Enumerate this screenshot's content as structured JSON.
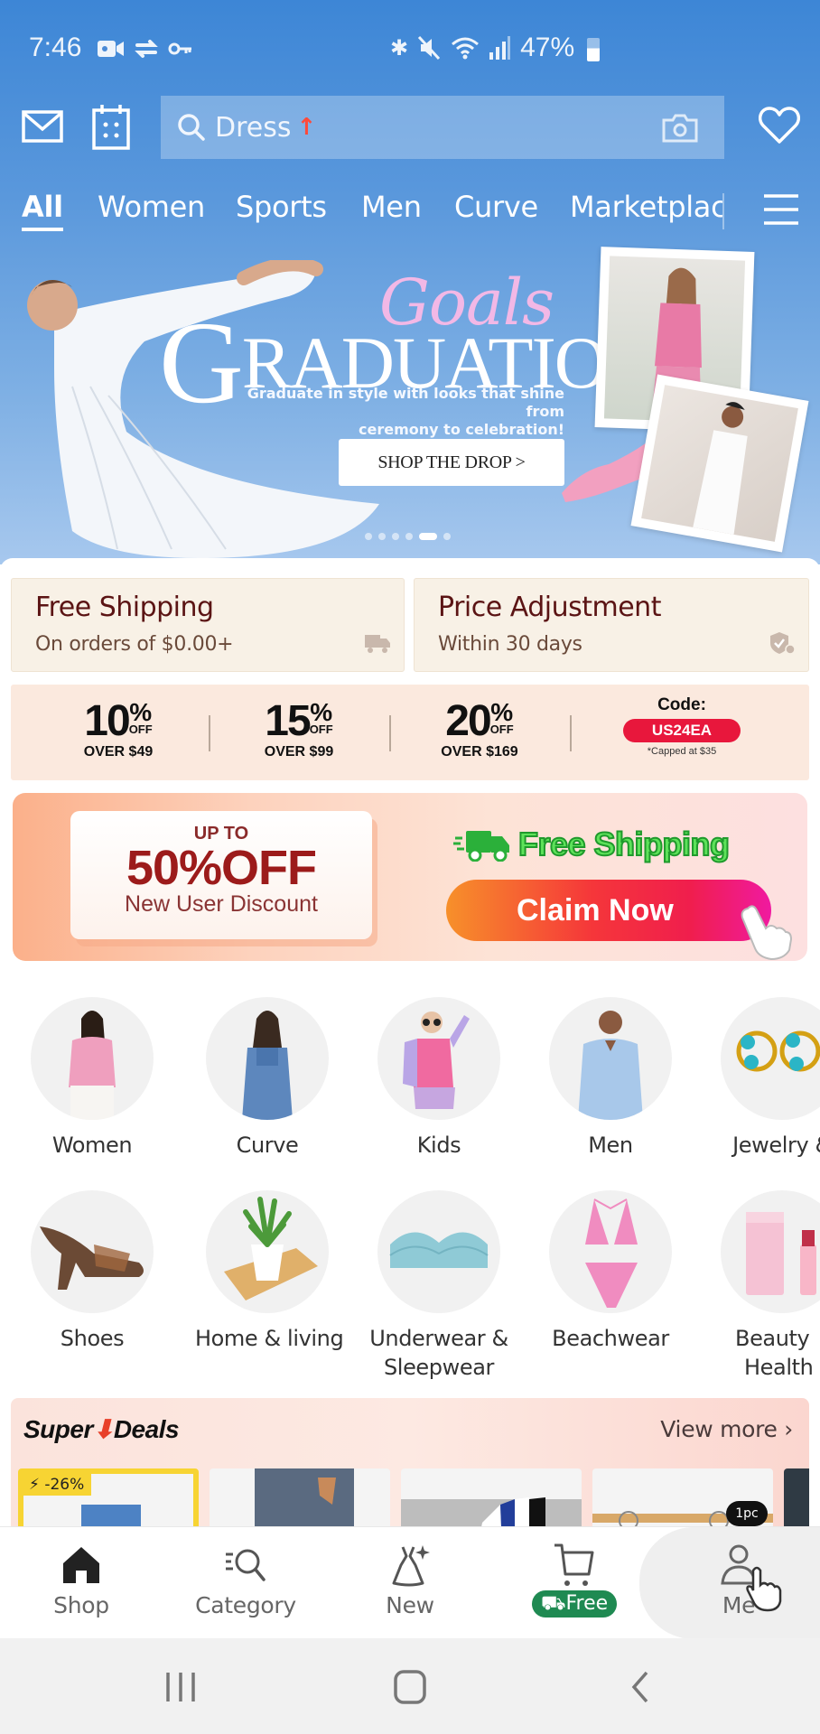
{
  "status_bar": {
    "time": "7:46",
    "left_icons": [
      "video-call-icon",
      "sync-icon",
      "key-icon"
    ],
    "right_icons": [
      "bluetooth-icon",
      "mute-icon",
      "wifi-icon",
      "signal-icon"
    ],
    "battery": "47%"
  },
  "header": {
    "search": {
      "term": "Dress",
      "trend_icon": "trending-up-arrow"
    },
    "tabs": [
      {
        "label": "All",
        "active": true
      },
      {
        "label": "Women"
      },
      {
        "label": "Sports"
      },
      {
        "label": "Men"
      },
      {
        "label": "Curve"
      },
      {
        "label": "Marketplace"
      }
    ]
  },
  "banner": {
    "script_title": "Goals",
    "title_initial": "G",
    "title_rest": "RADUATION",
    "subtitle_line1": "Graduate in style with looks that shine from",
    "subtitle_line2": "ceremony to celebration!",
    "cta": "SHOP THE DROP >",
    "slides_total": 6,
    "slide_active": 5
  },
  "services": [
    {
      "title": "Free Shipping",
      "subtitle": "On orders of $0.00+",
      "icon": "truck-icon"
    },
    {
      "title": "Price Adjustment",
      "subtitle": "Within 30 days",
      "icon": "shield-check-icon"
    }
  ],
  "coupons": {
    "tiers": [
      {
        "pct": "10",
        "over": "OVER $49"
      },
      {
        "pct": "15",
        "over": "OVER $99"
      },
      {
        "pct": "20",
        "over": "OVER $169"
      }
    ],
    "pct_symbol": "%",
    "off_label": "OFF",
    "code_label": "Code:",
    "code": "US24EA",
    "cap_note": "*Capped at $35"
  },
  "promo": {
    "up_to": "UP TO",
    "headline": "50%OFF",
    "subline": "New User Discount",
    "free_shipping": "Free Shipping",
    "cta": "Claim Now"
  },
  "categories": [
    {
      "label": "Women"
    },
    {
      "label": "Curve"
    },
    {
      "label": "Kids"
    },
    {
      "label": "Men"
    },
    {
      "label": "Jewelry &"
    },
    {
      "label": "Shoes"
    },
    {
      "label": "Home & living"
    },
    {
      "label": "Underwear &\nSleepwear",
      "line1": "Underwear &",
      "line2": "Sleepwear"
    },
    {
      "label": "Beachwear"
    },
    {
      "label": "Beauty Health",
      "line1": "Beauty",
      "line2": "Health"
    }
  ],
  "super_deals": {
    "logo_a": "Super",
    "logo_b": "Deals",
    "view_more": "View more",
    "badge_discount": "-26%",
    "badge_qty": "1pc"
  },
  "bottom_nav": [
    {
      "label": "Shop",
      "active": true
    },
    {
      "label": "Category"
    },
    {
      "label": "New"
    },
    {
      "label": "Free",
      "badge": true
    },
    {
      "label": "Me"
    }
  ],
  "colors": {
    "brand_header": "#3d86d6",
    "service_title": "#5b1414",
    "code_pill": "#e8173c",
    "free_pill": "#1f8a52",
    "deal_highlight": "#f7d433"
  }
}
